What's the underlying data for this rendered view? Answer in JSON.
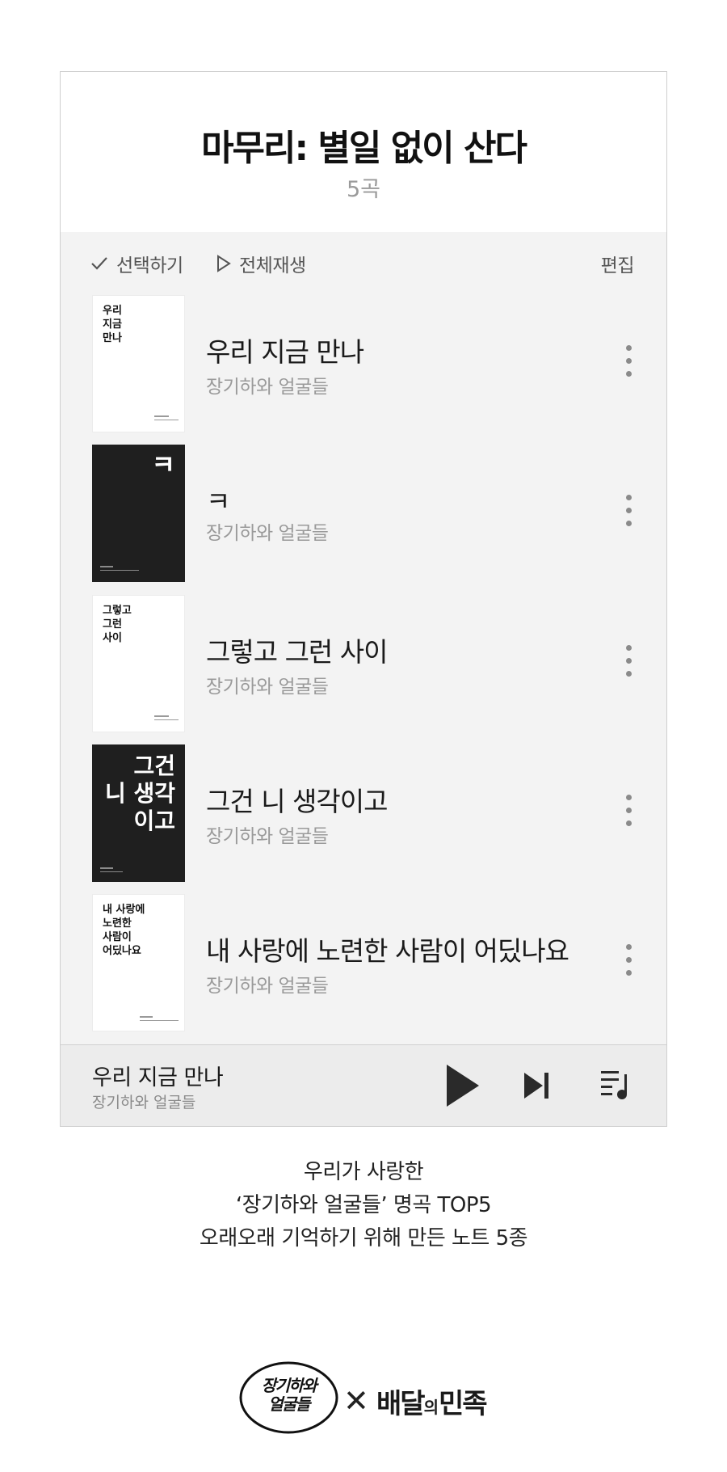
{
  "playlist": {
    "title": "마무리: 별일 없이 산다",
    "count": "5곡"
  },
  "toolbar": {
    "select_label": "선택하기",
    "play_all_label": "전체재생",
    "edit_label": "편집"
  },
  "songs": [
    {
      "title": "우리 지금 만나",
      "artist": "장기하와 얼굴들",
      "cover_text": "우리\n지금\n만나",
      "cover_style": "white"
    },
    {
      "title": "ㅋ",
      "artist": "장기하와 얼굴들",
      "cover_text": "ㅋ",
      "cover_style": "black"
    },
    {
      "title": "그렇고 그런 사이",
      "artist": "장기하와 얼굴들",
      "cover_text": "그렇고\n그런\n사이",
      "cover_style": "white"
    },
    {
      "title": "그건 니 생각이고",
      "artist": "장기하와 얼굴들",
      "cover_text": "그건\n니 생각\n이고",
      "cover_style": "black"
    },
    {
      "title": "내 사랑에 노련한 사람이 어딨나요",
      "artist": "장기하와 얼굴들",
      "cover_text": "내 사랑에\n노련한\n사람이\n어딨나요",
      "cover_style": "white"
    }
  ],
  "now_playing": {
    "title": "우리 지금 만나",
    "artist": "장기하와 얼굴들"
  },
  "icons": {
    "select": "check-icon",
    "play_all": "play-outline-icon",
    "more": "more-vertical-icon",
    "play": "play-icon",
    "next": "skip-next-icon",
    "queue": "playlist-queue-icon"
  },
  "caption": {
    "line1": "우리가 사랑한",
    "line2": "‘장기하와 얼굴들’ 명곡 TOP5",
    "line3": "오래오래 기억하기 위해 만든 노트 5종"
  },
  "brands": {
    "left_logo": "장기하와\n얼굴들",
    "cross": "✕",
    "right_main": "배달",
    "right_small": "의",
    "right_end": "민족"
  },
  "colors": {
    "panel_bg": "#f3f3f3",
    "header_bg": "#ffffff",
    "player_bg": "#ececec",
    "secondary_text": "#9a9a9a",
    "cover_black": "#1f1f1f"
  }
}
